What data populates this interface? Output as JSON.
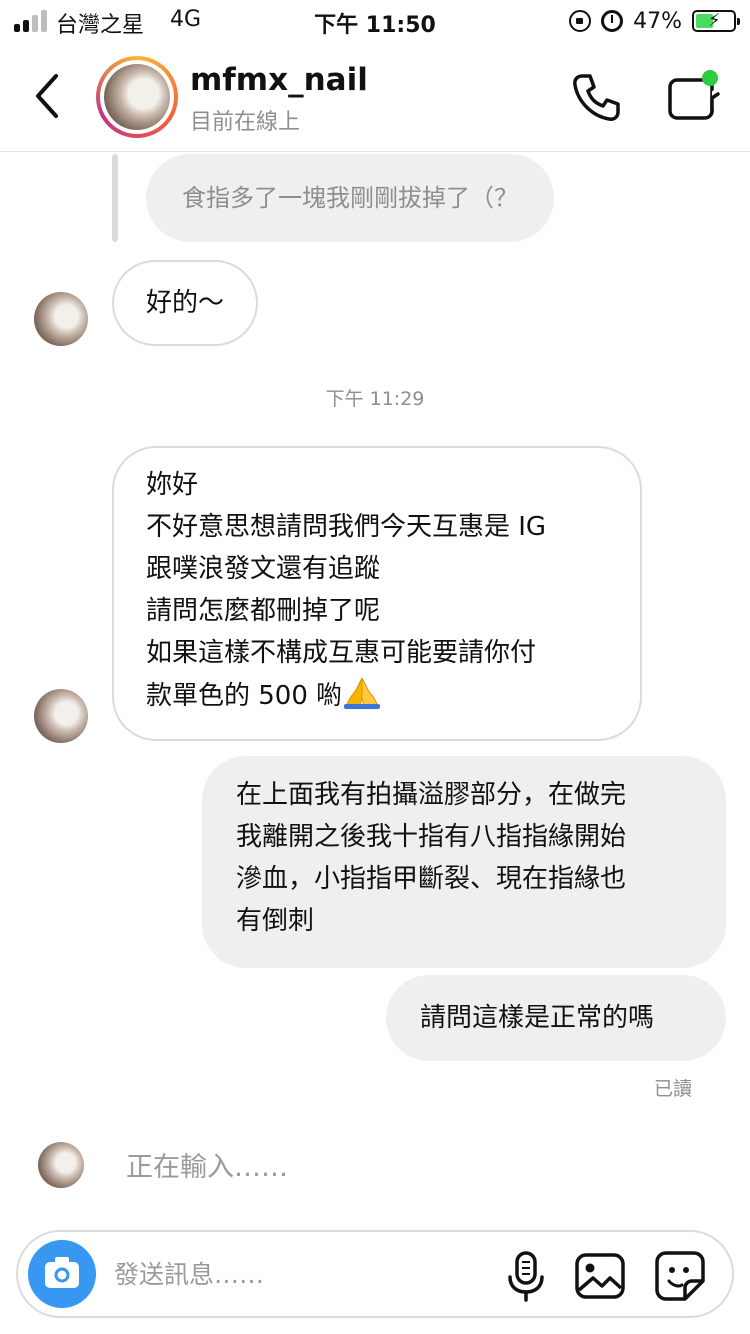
{
  "status_bar": {
    "carrier": "台灣之星",
    "network": "4G",
    "time": "下午 11:50",
    "battery_percent": "47%",
    "battery_level": 0.47,
    "signal_bars_active": 2,
    "icons": [
      "signal-icon",
      "orientation-lock-icon",
      "alarm-icon",
      "battery-charging-icon"
    ]
  },
  "header": {
    "username": "mfmx_nail",
    "status": "目前在線上",
    "icons": [
      "back-chevron-icon",
      "phone-icon",
      "video-call-icon"
    ],
    "online_dot_color": "#2ecc40"
  },
  "conversation": {
    "quoted_reply": "食指多了一塊我剛剛拔掉了（？",
    "messages": [
      {
        "sender": "them",
        "lines": [
          "好的～"
        ]
      },
      {
        "timestamp": "下午 11:29"
      },
      {
        "sender": "them",
        "lines": [
          "妳好",
          "不好意思想請問我們今天互惠是 IG",
          "跟噗浪發文還有追蹤",
          "請問怎麼都刪掉了呢",
          "如果這樣不構成互惠可能要請你付",
          "款單色的 500 喲"
        ],
        "emoji": "folded-hands-icon"
      },
      {
        "sender": "me",
        "lines": [
          "在上面我有拍攝溢膠部分，在做完",
          "我離開之後我十指有八指指緣開始",
          "滲血，小指指甲斷裂、現在指緣也",
          "有倒刺"
        ]
      },
      {
        "sender": "me",
        "lines": [
          "請問這樣是正常的嗎"
        ]
      }
    ],
    "seen_label": "已讀",
    "typing_label": "正在輸入……"
  },
  "composer": {
    "placeholder": "發送訊息……",
    "icons": [
      "camera-icon",
      "microphone-icon",
      "gallery-icon",
      "sticker-icon"
    ],
    "camera_color": "#3897f0"
  }
}
